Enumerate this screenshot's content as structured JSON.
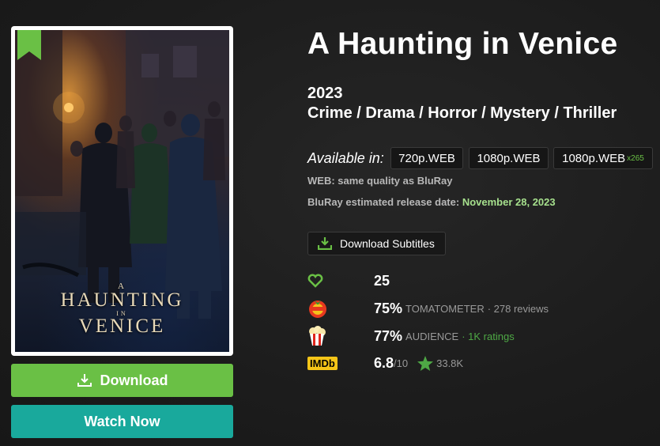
{
  "movie": {
    "title": "A Haunting in Venice",
    "year": "2023",
    "genres": "Crime / Drama / Horror / Mystery / Thriller",
    "poster_text": {
      "line1": "A",
      "line2": "HAUNTING",
      "line3": "IN",
      "line4": "VENICE"
    }
  },
  "actions": {
    "download_label": "Download",
    "watch_label": "Watch Now",
    "subtitles_label": "Download Subtitles"
  },
  "availability": {
    "label": "Available in:",
    "qualities": [
      {
        "label": "720p.WEB",
        "extra": ""
      },
      {
        "label": "1080p.WEB",
        "extra": ""
      },
      {
        "label": "1080p.WEB",
        "extra": "x265"
      }
    ],
    "web_note": "WEB: same quality as BluRay",
    "bluray_label": "BluRay estimated release date:",
    "bluray_date": "November 28, 2023"
  },
  "ratings": {
    "likes": "25",
    "tomatometer": {
      "score": "75%",
      "label": "TOMATOMETER",
      "reviews": "· 278 reviews"
    },
    "audience": {
      "score": "77%",
      "label": "AUDIENCE",
      "ratings": "· 1K ratings"
    },
    "imdb": {
      "badge": "IMDb",
      "score": "6.8",
      "scale": "/10",
      "votes": "33.8K"
    }
  },
  "colors": {
    "green": "#6ac045",
    "teal": "#19a99c",
    "imdb_yellow": "#f5c518",
    "light_green": "#a6e08d"
  },
  "icons": [
    "bookmark-ribbon-icon",
    "download-icon",
    "heart-icon",
    "fresh-tomato-icon",
    "popcorn-icon",
    "imdb-logo",
    "star-icon"
  ]
}
